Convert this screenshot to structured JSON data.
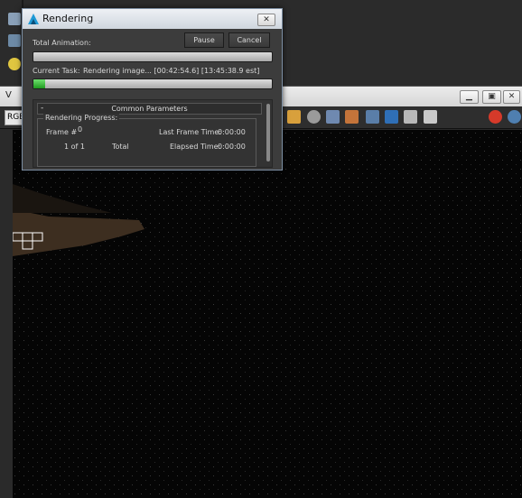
{
  "background_toolbar": {
    "icons": [
      "render-setup-icon",
      "render-frame-icon",
      "light-bulb-icon"
    ]
  },
  "frame_buffer": {
    "title_initial": "V",
    "channel_select": "RGB",
    "window_buttons": [
      "minimize",
      "restore",
      "close"
    ]
  },
  "dialog": {
    "title": "Rendering",
    "pause_label": "Pause",
    "cancel_label": "Cancel",
    "close_symbol": "✕",
    "total_animation_label": "Total Animation:",
    "total_animation_progress": 0.0,
    "current_task_label": "Current Task:",
    "current_task_value": "Rendering image... [00:42:54.6] [13:45:38.9 est]",
    "current_task_progress": 0.05,
    "common_parameters": {
      "collapse_symbol": "-",
      "header": "Common Parameters",
      "group_title": "Rendering Progress:",
      "frame_label": "Frame #",
      "frame_value": "0",
      "frame_count": "1 of 1",
      "total_label": "Total",
      "last_frame_time_label": "Last Frame Time:",
      "last_frame_time_value": "0:00:00",
      "elapsed_time_label": "Elapsed Time:",
      "elapsed_time_value": "0:00:00"
    }
  },
  "colors": {
    "progress_green": "#2bb52b",
    "dialog_bg": "#3c3c3c",
    "canvas_bg": "#050505"
  }
}
